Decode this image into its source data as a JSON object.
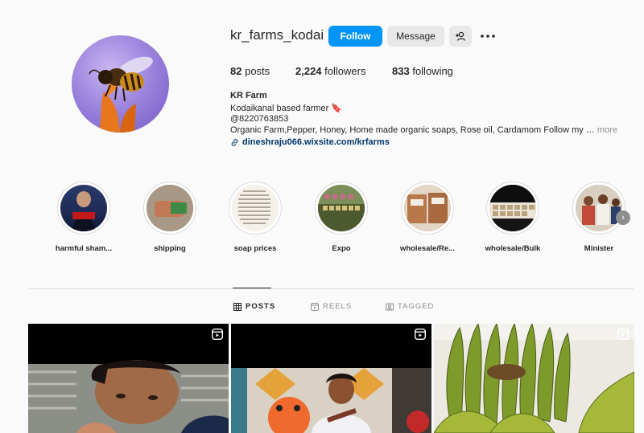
{
  "profile": {
    "username": "kr_farms_kodai",
    "follow_label": "Follow",
    "message_label": "Message",
    "stats": {
      "posts_count": "82",
      "posts_label": "posts",
      "followers_count": "2,224",
      "followers_label": "followers",
      "following_count": "833",
      "following_label": "following"
    },
    "bio": {
      "name": "KR Farm",
      "line1": "Kodaikanal based farmer 🔖",
      "line2": "@8220763853",
      "line3": "Organic Farm,Pepper, Honey, Home made organic soaps, Rose oil, Cardamom Follow my …",
      "more_label": "more",
      "link": "dineshraju066.wixsite.com/krfarms"
    }
  },
  "highlights": [
    {
      "label": "harmful sham..."
    },
    {
      "label": "shipping"
    },
    {
      "label": "soap prices"
    },
    {
      "label": "Expo"
    },
    {
      "label": "wholesale/Re..."
    },
    {
      "label": "wholesale/Bulk"
    },
    {
      "label": "Minister"
    }
  ],
  "tabs": [
    {
      "label": "POSTS",
      "icon": "grid-icon",
      "active": true
    },
    {
      "label": "REELS",
      "icon": "reels-icon",
      "active": false
    },
    {
      "label": "TAGGED",
      "icon": "tag-icon",
      "active": false
    }
  ],
  "colors": {
    "follow_button": "#0095f6",
    "link": "#00376b",
    "background": "#fafafa"
  }
}
